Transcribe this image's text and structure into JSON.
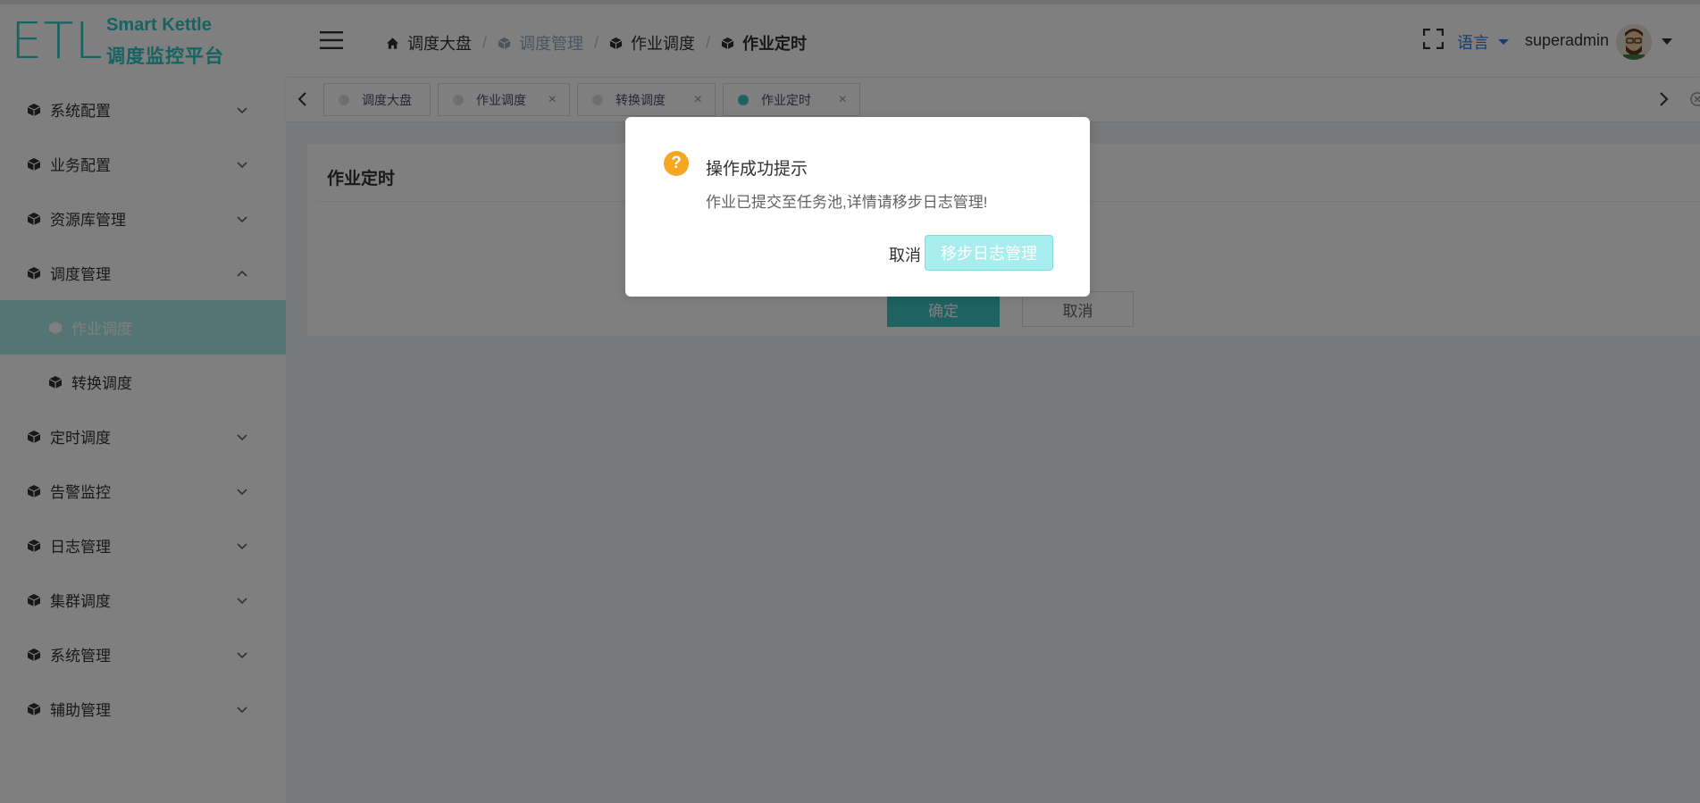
{
  "logo": {
    "mark": "ETL",
    "line1": "Smart Kettle",
    "line2": "调度监控平台"
  },
  "sidebar": {
    "items": [
      {
        "label": "系统配置",
        "icon": "cube-icon",
        "chevron": "down"
      },
      {
        "label": "业务配置",
        "icon": "cube-icon",
        "chevron": "down"
      },
      {
        "label": "资源库管理",
        "icon": "cube-icon",
        "chevron": "down"
      },
      {
        "label": "调度管理",
        "icon": "cube-icon",
        "chevron": "up"
      },
      {
        "label": "作业调度",
        "icon": "cube-icon",
        "sub": true,
        "active": true
      },
      {
        "label": "转换调度",
        "icon": "cube-icon",
        "sub": true
      },
      {
        "label": "定时调度",
        "icon": "cube-icon",
        "chevron": "down"
      },
      {
        "label": "告警监控",
        "icon": "cube-icon",
        "chevron": "down"
      },
      {
        "label": "日志管理",
        "icon": "cube-icon",
        "chevron": "down"
      },
      {
        "label": "集群调度",
        "icon": "cube-icon",
        "chevron": "down"
      },
      {
        "label": "系统管理",
        "icon": "cube-icon",
        "chevron": "down"
      },
      {
        "label": "辅助管理",
        "icon": "cube-icon",
        "chevron": "down"
      }
    ]
  },
  "header": {
    "breadcrumb": [
      {
        "label": "调度大盘",
        "icon": "home-icon"
      },
      {
        "label": "调度管理",
        "icon": "cube-icon"
      },
      {
        "label": "作业调度",
        "icon": "cube-icon"
      },
      {
        "label": "作业定时",
        "icon": "cube-icon"
      }
    ],
    "language": "语言",
    "username": "superadmin"
  },
  "tabs": [
    {
      "label": "调度大盘",
      "closable": false
    },
    {
      "label": "作业调度",
      "closable": true
    },
    {
      "label": "转换调度",
      "closable": true
    },
    {
      "label": "作业定时",
      "closable": true,
      "active": true
    }
  ],
  "main": {
    "title": "作业定时",
    "confirm_label": "确定",
    "cancel_label": "取消"
  },
  "dialog": {
    "icon": "?",
    "title": "操作成功提示",
    "message": "作业已提交至任务池,详情请移步日志管理!",
    "cancel_label": "取消",
    "ok_label": "移步日志管理"
  },
  "colors": {
    "brand": "#2cc7c4",
    "active_menu": "#a8eae9",
    "link": "#2a7ce0",
    "warning": "#f5a623"
  }
}
